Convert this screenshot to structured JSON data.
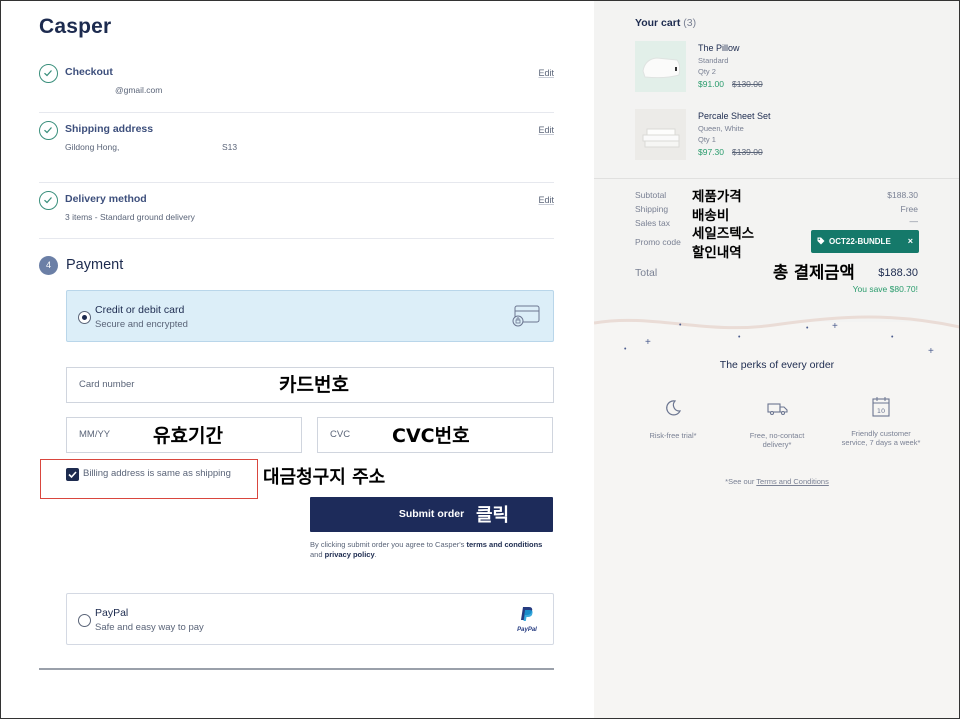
{
  "brand": {
    "logo_text": "Casper"
  },
  "steps": {
    "checkout": {
      "title": "Checkout",
      "detail": "@gmail.com",
      "edit": "Edit"
    },
    "shipping": {
      "title": "Shipping address",
      "detail": "Gildong Hong,",
      "detail_extra": "S13",
      "edit": "Edit"
    },
    "delivery": {
      "title": "Delivery method",
      "detail": "3 items - Standard ground delivery",
      "edit": "Edit"
    }
  },
  "payment": {
    "step_number": "4",
    "title": "Payment",
    "card_option": {
      "title": "Credit or debit card",
      "subtitle": "Secure and encrypted",
      "selected": true
    },
    "card_number_placeholder": "Card number",
    "expiry_placeholder": "MM/YY",
    "cvc_placeholder": "CVC",
    "billing_checkbox": {
      "label": "Billing address is same as shipping",
      "checked": true
    },
    "submit_label": "Submit order",
    "terms_prefix": "By clicking submit order you agree to Casper's ",
    "terms_link": "terms and conditions",
    "terms_mid": " and ",
    "privacy_link": "privacy policy",
    "terms_suffix": ".",
    "paypal_option": {
      "title": "PayPal",
      "subtitle": "Safe and easy way to pay",
      "logo_text": "PayPal",
      "selected": false
    }
  },
  "annotations": {
    "card_number": "카드번호",
    "expiry": "유효기간",
    "cvc": "CVC번호",
    "billing": "대금청구지 주소",
    "submit": "클릭",
    "subtotal": "제품가격",
    "shipping": "배송비",
    "sales_tax": "세일즈텍스",
    "promo": "할인내역",
    "total": "총 결제금액"
  },
  "cart": {
    "title": "Your cart",
    "count": "(3)",
    "items": [
      {
        "name": "The Pillow",
        "option1": "Standard",
        "option2": "Qty 2",
        "price": "$91.00",
        "was_price": "$130.00"
      },
      {
        "name": "Percale Sheet Set",
        "option1": "Queen, White",
        "option2": "Qty 1",
        "price": "$97.30",
        "was_price": "$139.00"
      }
    ],
    "summary": {
      "subtotal_label": "Subtotal",
      "subtotal_value": "$188.30",
      "shipping_label": "Shipping",
      "shipping_value": "Free",
      "tax_label": "Sales tax",
      "tax_value": "—",
      "promo_label": "Promo code",
      "promo_code": "OCT22-BUNDLE",
      "promo_remove": "×",
      "total_label": "Total",
      "total_value": "$188.30",
      "savings": "You save $80.70!"
    }
  },
  "perks": {
    "title": "The perks of every order",
    "items": [
      {
        "icon": "moon-icon",
        "label_line1": "Risk-free trial*",
        "label_line2": ""
      },
      {
        "icon": "truck-icon",
        "label_line1": "Free, no-contact",
        "label_line2": "delivery*"
      },
      {
        "icon": "calendar-icon",
        "label_line1": "Friendly customer",
        "label_line2": "service, 7 days a week*"
      }
    ],
    "footnote_prefix": "*See our ",
    "footnote_link": "Terms and Conditions"
  },
  "colors": {
    "navy": "#1d2b5a",
    "teal_check": "#3a8f7c",
    "promo_green": "#15796a",
    "price_green": "#2a9c6d",
    "selected_option_bg": "#dceef8",
    "highlight_red": "#d9463e"
  }
}
